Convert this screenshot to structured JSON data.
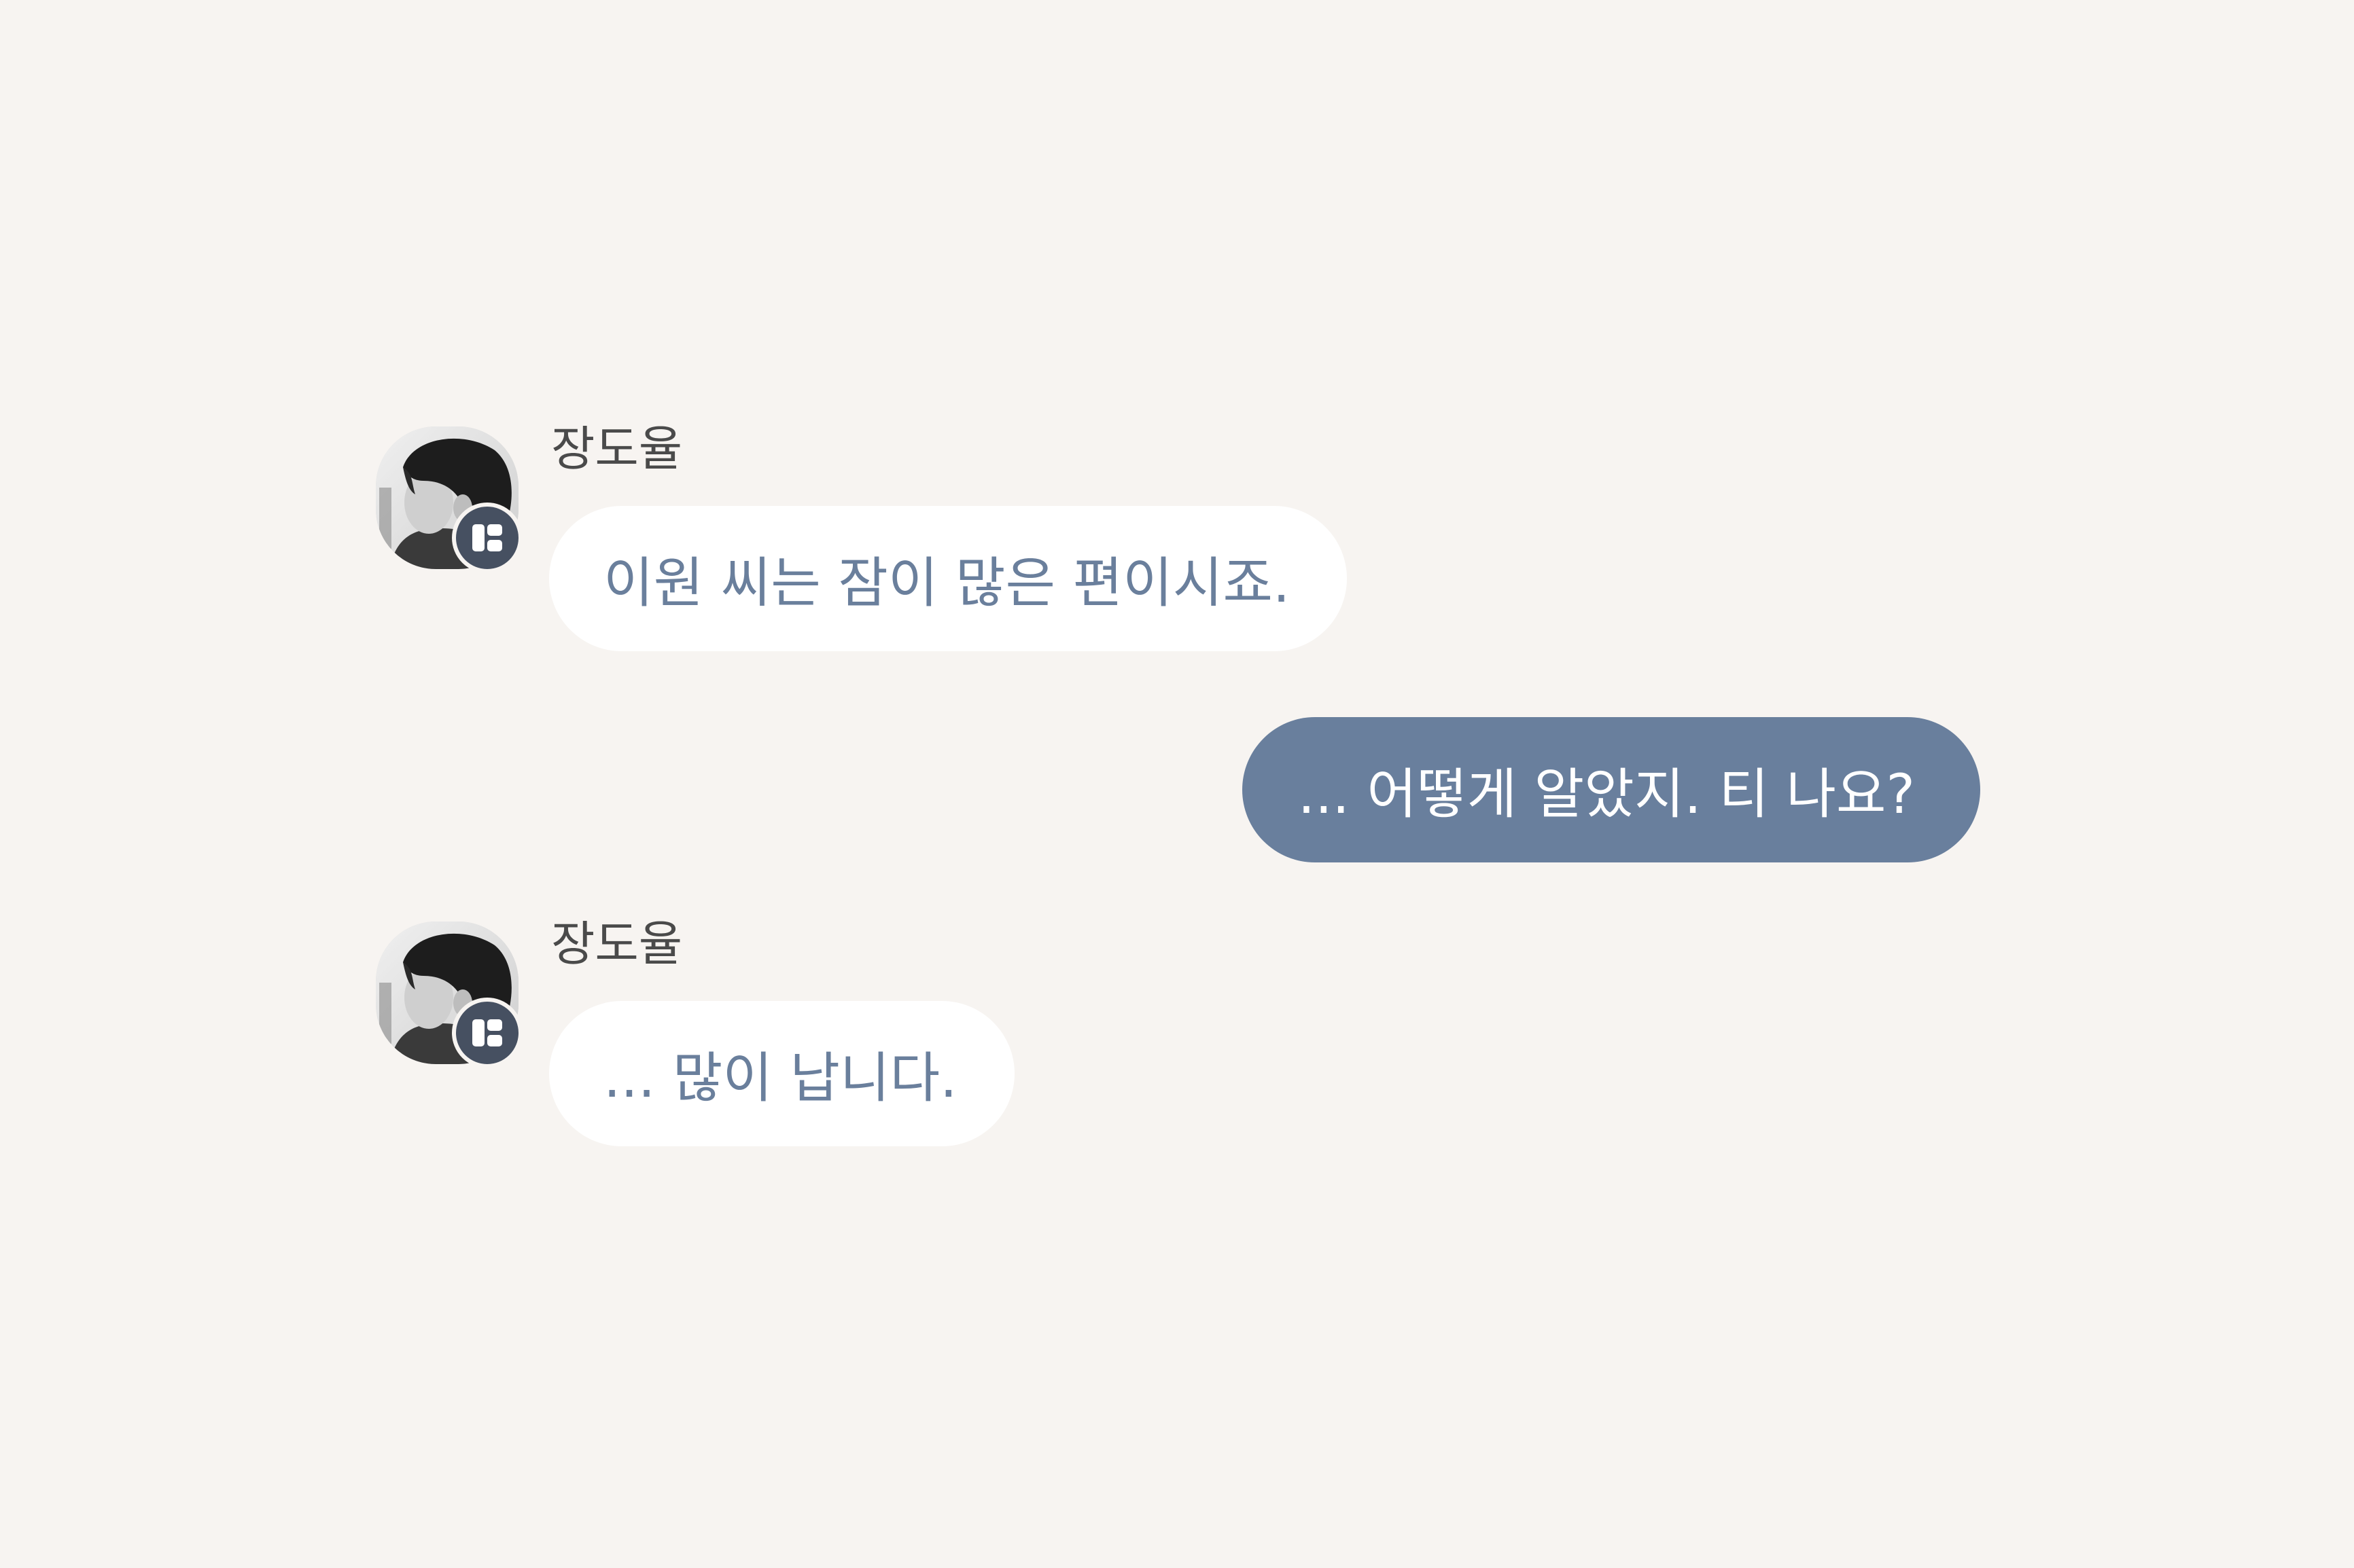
{
  "messages": [
    {
      "direction": "incoming",
      "sender": "장도율",
      "text": "이원 씨는 잠이 많은 편이시죠.",
      "avatar_icon": "profile-photo",
      "badge_icon": "app-badge-icon"
    },
    {
      "direction": "outgoing",
      "text": "... 어떻게 알았지. 티 나요?"
    },
    {
      "direction": "incoming",
      "sender": "장도율",
      "text": "... 많이 납니다.",
      "avatar_icon": "profile-photo",
      "badge_icon": "app-badge-icon"
    }
  ],
  "colors": {
    "background": "#f7f4f1",
    "incoming_bubble": "#ffffff",
    "incoming_text": "#6a7f9c",
    "outgoing_bubble": "#697f9d",
    "outgoing_text": "#ffffff",
    "badge": "#465061",
    "sender_name": "#4a4a4a"
  }
}
